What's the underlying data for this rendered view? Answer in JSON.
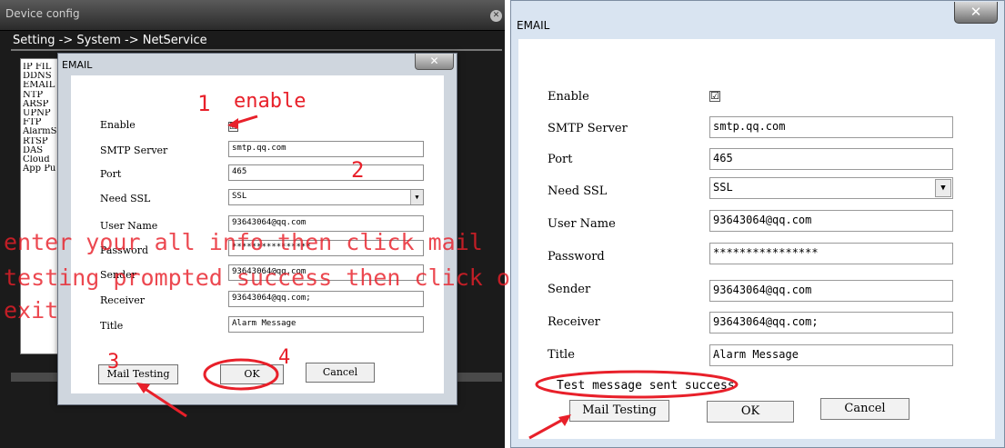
{
  "left": {
    "window_title": "Device config",
    "close_glyph": "✕",
    "breadcrumb": "Setting -> System -> NetService",
    "nav_items": [
      "IP FIL",
      "DDNS",
      "EMAIL",
      "NTP",
      "ARSP",
      "UPNP",
      "FTP",
      "AlarmS",
      "RTSP",
      "DAS",
      "Cloud",
      "App Pu"
    ],
    "dialog": {
      "title": "EMAIL",
      "close_glyph": "✕",
      "labels": {
        "enable": "Enable",
        "smtp": "SMTP Server",
        "port": "Port",
        "ssl": "Need SSL",
        "user": "User Name",
        "password": "Password",
        "sender": "Sender",
        "receiver": "Receiver",
        "title": "Title"
      },
      "values": {
        "enable_check": "☑",
        "smtp": "smtp.qq.com",
        "port": "465",
        "ssl": "SSL",
        "user": "93643064@qq.com",
        "password": "****************",
        "sender": "93643064@qq.com",
        "receiver": "93643064@qq.com;",
        "title": "Alarm Message"
      },
      "select_arrow": "▼",
      "buttons": {
        "mail_testing": "Mail Testing",
        "ok": "OK",
        "cancel": "Cancel"
      }
    },
    "annotations": {
      "step1": "1",
      "step1_text": "enable",
      "step2": "2",
      "step3": "3",
      "step4": "4",
      "note_line1": "enter your all info then click mail",
      "note_line2": "testing prompted success then click ok",
      "note_line3": "exit"
    }
  },
  "right": {
    "title": "EMAIL",
    "close_glyph": "✕",
    "labels": {
      "enable": "Enable",
      "smtp": "SMTP Server",
      "port": "Port",
      "ssl": "Need SSL",
      "user": "User Name",
      "password": "Password",
      "sender": "Sender",
      "receiver": "Receiver",
      "title": "Title"
    },
    "values": {
      "enable_check": "☑",
      "smtp": "smtp.qq.com",
      "port": "465",
      "ssl": "SSL",
      "user": "93643064@qq.com",
      "password": "****************",
      "sender": "93643064@qq.com",
      "receiver": "93643064@qq.com;",
      "title": "Alarm Message"
    },
    "select_arrow": "▼",
    "status": "Test message sent success",
    "buttons": {
      "mail_testing": "Mail Testing",
      "ok": "OK",
      "cancel": "Cancel"
    }
  },
  "colors": {
    "annotation_red": "#e8202a"
  }
}
